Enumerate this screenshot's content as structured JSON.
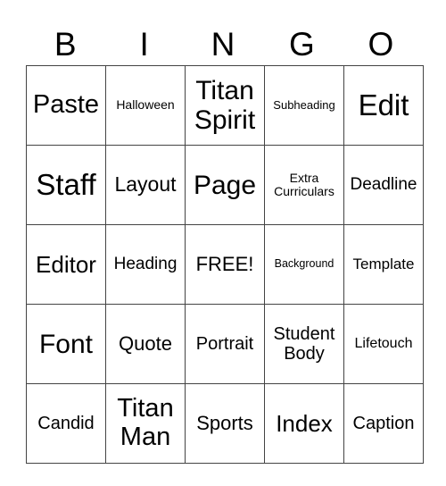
{
  "header": [
    "B",
    "I",
    "N",
    "G",
    "O"
  ],
  "rows": [
    [
      "Paste",
      "Halloween",
      "Titan Spirit",
      "Subheading",
      "Edit"
    ],
    [
      "Staff",
      "Layout",
      "Page",
      "Extra Curriculars",
      "Deadline"
    ],
    [
      "Editor",
      "Heading",
      "FREE!",
      "Background",
      "Template"
    ],
    [
      "Font",
      "Quote",
      "Portrait",
      "Student Body",
      "Lifetouch"
    ],
    [
      "Candid",
      "Titan Man",
      "Sports",
      "Index",
      "Caption"
    ]
  ]
}
